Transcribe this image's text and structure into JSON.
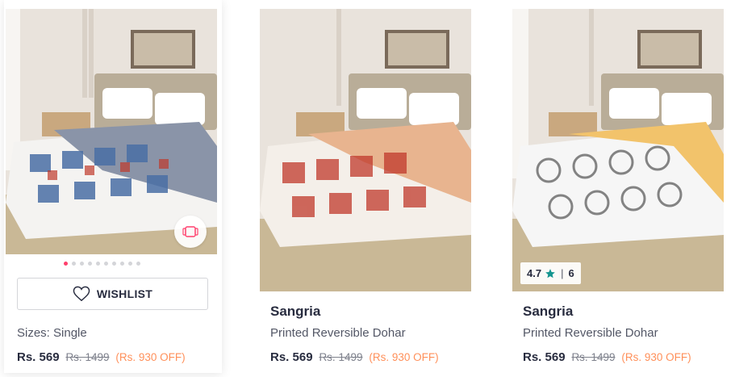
{
  "products": [
    {
      "sizes_label": "Sizes: Single",
      "wishlist_label": "WISHLIST",
      "price": "Rs. 569",
      "mrp": "Rs. 1499",
      "discount": "(Rs. 930 OFF)",
      "carousel_dot_count": 10,
      "carousel_active_index": 0,
      "pattern_color": "#4a6fa5"
    },
    {
      "brand": "Sangria",
      "product_name": "Printed Reversible Dohar",
      "price": "Rs. 569",
      "mrp": "Rs. 1499",
      "discount": "(Rs. 930 OFF)",
      "pattern_color": "#c0392b"
    },
    {
      "brand": "Sangria",
      "product_name": "Printed Reversible Dohar",
      "price": "Rs. 569",
      "mrp": "Rs. 1499",
      "discount": "(Rs. 930 OFF)",
      "rating": "4.7",
      "rating_count": "6",
      "rating_separator": "|",
      "pattern_color": "#707070"
    }
  ],
  "colors": {
    "discount": "#ff905a",
    "rating_star": "#14958f",
    "carousel_active": "#ff3f6c"
  }
}
